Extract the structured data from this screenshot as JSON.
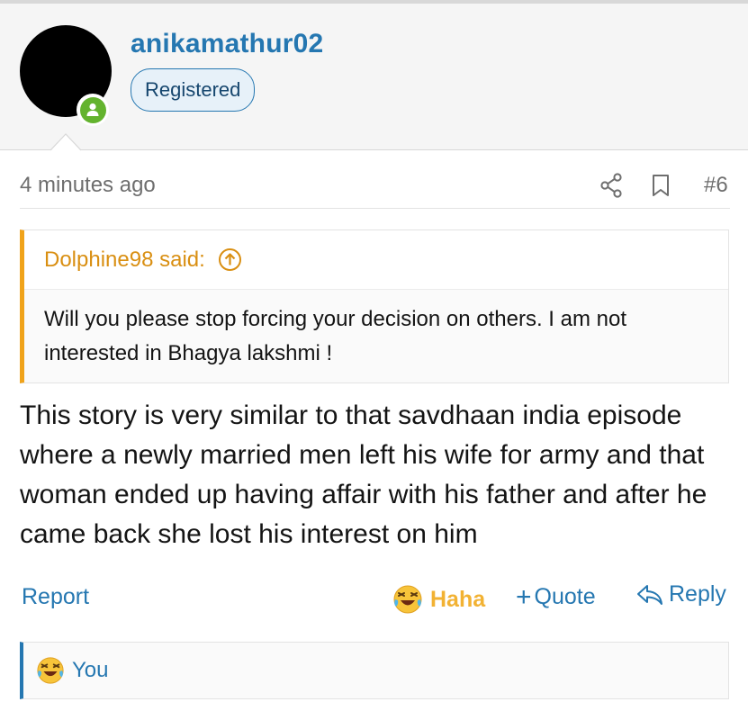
{
  "user": {
    "name": "anikamathur02",
    "badge": "Registered",
    "online": true
  },
  "post": {
    "time": "4 minutes ago",
    "number": "#6",
    "quote": {
      "author_label": "Dolphine98 said:",
      "text": "Will you please stop forcing your decision on others. I am not interested in Bhagya lakshmi !"
    },
    "body": "This story is very similar to that savdhaan india episode where a newly married men left his wife for army and that woman ended up having affair with his father and after he came back she lost his interest on him"
  },
  "actions": {
    "report": "Report",
    "reaction": "Haha",
    "quote": "Quote",
    "reply": "Reply"
  },
  "reactions": {
    "summary": "You"
  },
  "colors": {
    "link": "#2577b1",
    "quote_accent": "#f0a31a",
    "haha": "#f2b233",
    "online": "#63b32e"
  },
  "icons": [
    "share-icon",
    "bookmark-icon",
    "arrow-up-circle-icon",
    "laughing-emoji-icon",
    "plus-icon",
    "reply-icon"
  ]
}
